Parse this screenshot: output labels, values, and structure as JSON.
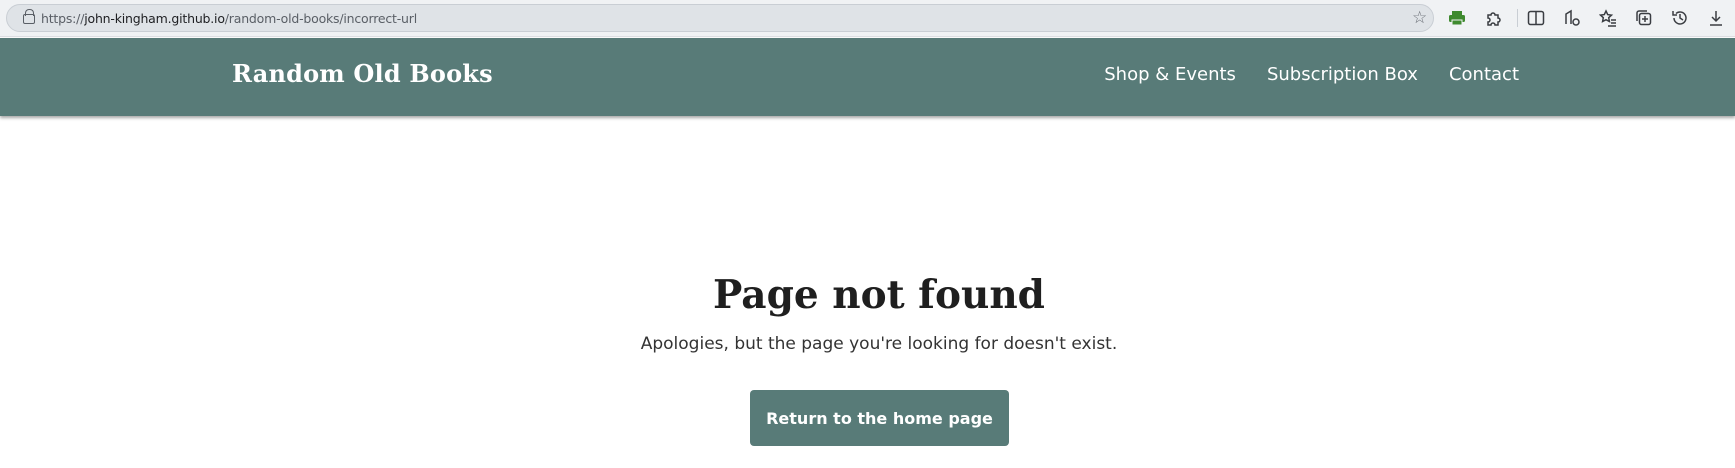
{
  "browser": {
    "url_scheme": "https://",
    "url_host": "john-kingham.github.io",
    "url_path": "/random-old-books/incorrect-url",
    "toolbar_icons": [
      "printer-icon",
      "extensions-icon",
      "split-screen-icon",
      "read-aloud-icon",
      "favorites-icon",
      "collections-icon",
      "history-icon",
      "downloads-icon"
    ]
  },
  "header": {
    "logo": "Random Old Books",
    "nav": [
      {
        "label": "Shop & Events"
      },
      {
        "label": "Subscription Box"
      },
      {
        "label": "Contact"
      }
    ],
    "background": "#587b78"
  },
  "main": {
    "title": "Page not found",
    "message": "Apologies, but the page you're looking for doesn't exist.",
    "button_label": "Return to the home page"
  },
  "colors": {
    "accent": "#587b78",
    "print_icon": "#3f8a2f"
  }
}
